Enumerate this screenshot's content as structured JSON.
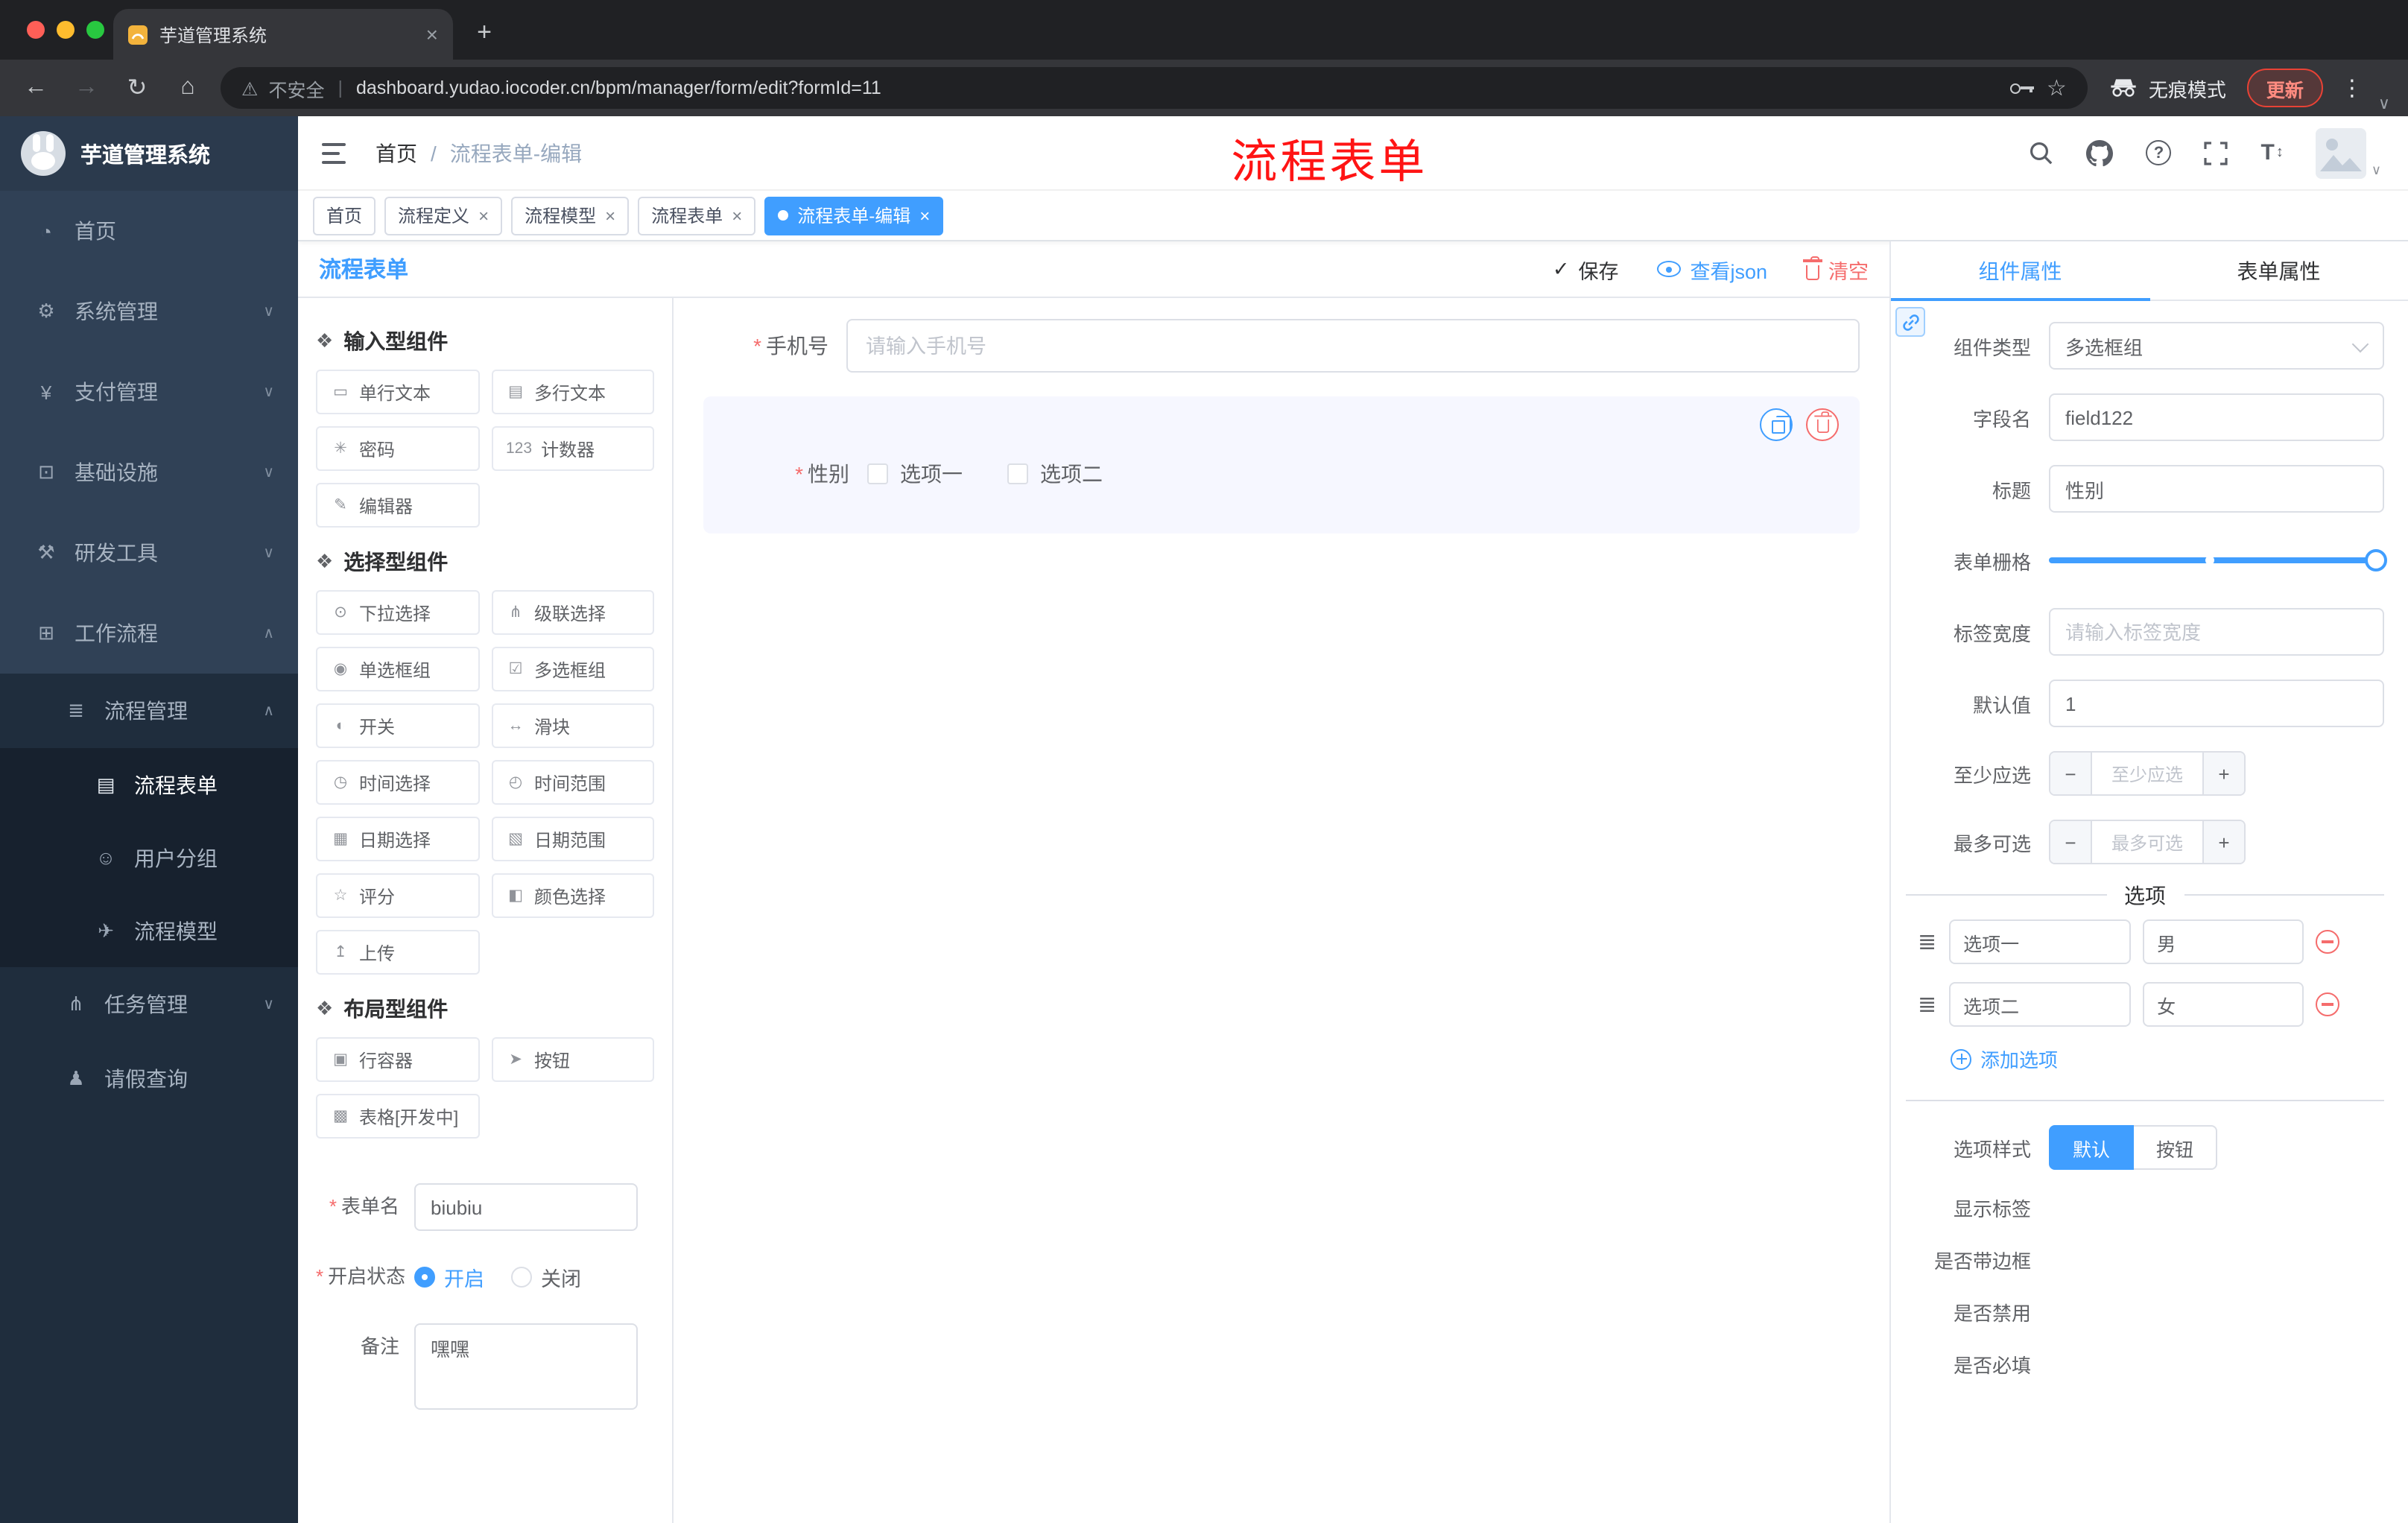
{
  "colors": {
    "accent": "#409eff",
    "danger": "#f56c6c",
    "sidebar_bg": "#304156",
    "sidebar_sub_bg": "#1f2d3d",
    "annotation_red": "#ff1414",
    "active_tag_bg": "#409eff",
    "update_button_red": "#e94235"
  },
  "icons": {
    "close": "×",
    "plus": "+",
    "back": "←",
    "forward": "→",
    "reload": "↻",
    "home": "⌂",
    "warning": "⚠",
    "pipe": "|",
    "star": "☆",
    "dots": "⋮",
    "chevron_down": "∨",
    "breadcrumb_sep": "/",
    "required": "*",
    "check": "✓",
    "help": "?",
    "font_t": "T",
    "font_arrows": "↕",
    "minus": "−",
    "drag": "≣"
  },
  "browser": {
    "tab_title": "芋道管理系统",
    "security_label": "不安全",
    "url": "dashboard.yudao.iocoder.cn/bpm/manager/form/edit?formId=11",
    "incognito_label": "无痕模式",
    "update_label": "更新"
  },
  "sidebar": {
    "logo_title": "芋道管理系统",
    "items": [
      {
        "icon": "◔",
        "label": "首页"
      },
      {
        "icon": "⚙",
        "label": "系统管理",
        "arrow": "∨"
      },
      {
        "icon": "¥",
        "label": "支付管理",
        "arrow": "∨"
      },
      {
        "icon": "⊡",
        "label": "基础设施",
        "arrow": "∨"
      },
      {
        "icon": "⚒",
        "label": "研发工具",
        "arrow": "∨"
      },
      {
        "icon": "⊞",
        "label": "工作流程",
        "arrow": "∧"
      },
      {
        "icon": "≣",
        "label": "流程管理",
        "arrow": "∧"
      },
      {
        "icon": "▤",
        "label": "流程表单"
      },
      {
        "icon": "☺",
        "label": "用户分组"
      },
      {
        "icon": "✈",
        "label": "流程模型"
      },
      {
        "icon": "⋔",
        "label": "任务管理",
        "arrow": "∨"
      },
      {
        "icon": "♟",
        "label": "请假查询"
      }
    ]
  },
  "header": {
    "breadcrumb_home": "首页",
    "breadcrumb_current": "流程表单-编辑",
    "annotation": "流程表单"
  },
  "tags": [
    {
      "label": "首页"
    },
    {
      "label": "流程定义"
    },
    {
      "label": "流程模型"
    },
    {
      "label": "流程表单"
    },
    {
      "label": "流程表单-编辑"
    }
  ],
  "editor": {
    "panel_title": "流程表单",
    "save": "保存",
    "view_json": "查看json",
    "clear": "清空"
  },
  "palette": {
    "groups": [
      {
        "icon": "❖",
        "title": "输入型组件",
        "items": [
          {
            "icon": "▭",
            "label": "单行文本"
          },
          {
            "icon": "▤",
            "label": "多行文本"
          },
          {
            "icon": "✳",
            "label": "密码"
          },
          {
            "icon": "123",
            "label": "计数器"
          },
          {
            "icon": "✎",
            "label": "编辑器"
          }
        ]
      },
      {
        "icon": "❖",
        "title": "选择型组件",
        "items": [
          {
            "icon": "⊙",
            "label": "下拉选择"
          },
          {
            "icon": "⋔",
            "label": "级联选择"
          },
          {
            "icon": "◉",
            "label": "单选框组"
          },
          {
            "icon": "☑",
            "label": "多选框组"
          },
          {
            "icon": "◐",
            "label": "开关"
          },
          {
            "icon": "↔",
            "label": "滑块"
          },
          {
            "icon": "◷",
            "label": "时间选择"
          },
          {
            "icon": "◴",
            "label": "时间范围"
          },
          {
            "icon": "▦",
            "label": "日期选择"
          },
          {
            "icon": "▧",
            "label": "日期范围"
          },
          {
            "icon": "☆",
            "label": "评分"
          },
          {
            "icon": "◧",
            "label": "颜色选择"
          },
          {
            "icon": "↥",
            "label": "上传"
          }
        ]
      },
      {
        "icon": "❖",
        "title": "布局型组件",
        "items": [
          {
            "icon": "▣",
            "label": "行容器"
          },
          {
            "icon": "➤",
            "label": "按钮"
          },
          {
            "icon": "▩",
            "label": "表格[开发中]"
          }
        ]
      }
    ],
    "form": {
      "name_label": "表单名",
      "name_value": "biubiu",
      "status_label": "开启状态",
      "status_on": "开启",
      "status_off": "关闭",
      "remark_label": "备注",
      "remark_value": "嘿嘿"
    }
  },
  "canvas": {
    "phone_label": "手机号",
    "phone_placeholder": "请输入手机号",
    "gender_label": "性别",
    "gender_opt1": "选项一",
    "gender_opt2": "选项二"
  },
  "props": {
    "tab_component": "组件属性",
    "tab_form": "表单属性",
    "type_label": "组件类型",
    "type_value": "多选框组",
    "field_label": "字段名",
    "field_value": "field122",
    "title_label": "标题",
    "title_value": "性别",
    "grid_label": "表单栅格",
    "width_label": "标签宽度",
    "width_placeholder": "请输入标签宽度",
    "default_label": "默认值",
    "default_value": "1",
    "min_label": "至少应选",
    "min_placeholder": "至少应选",
    "max_label": "最多可选",
    "max_placeholder": "最多可选",
    "options_title": "选项",
    "opt1_label": "选项一",
    "opt1_value": "男",
    "opt2_label": "选项二",
    "opt2_value": "女",
    "add_option": "添加选项",
    "style_label": "选项样式",
    "style_default": "默认",
    "style_button": "按钮",
    "switch1": "显示标签",
    "switch2": "是否带边框",
    "switch3": "是否禁用",
    "switch4": "是否必填"
  }
}
